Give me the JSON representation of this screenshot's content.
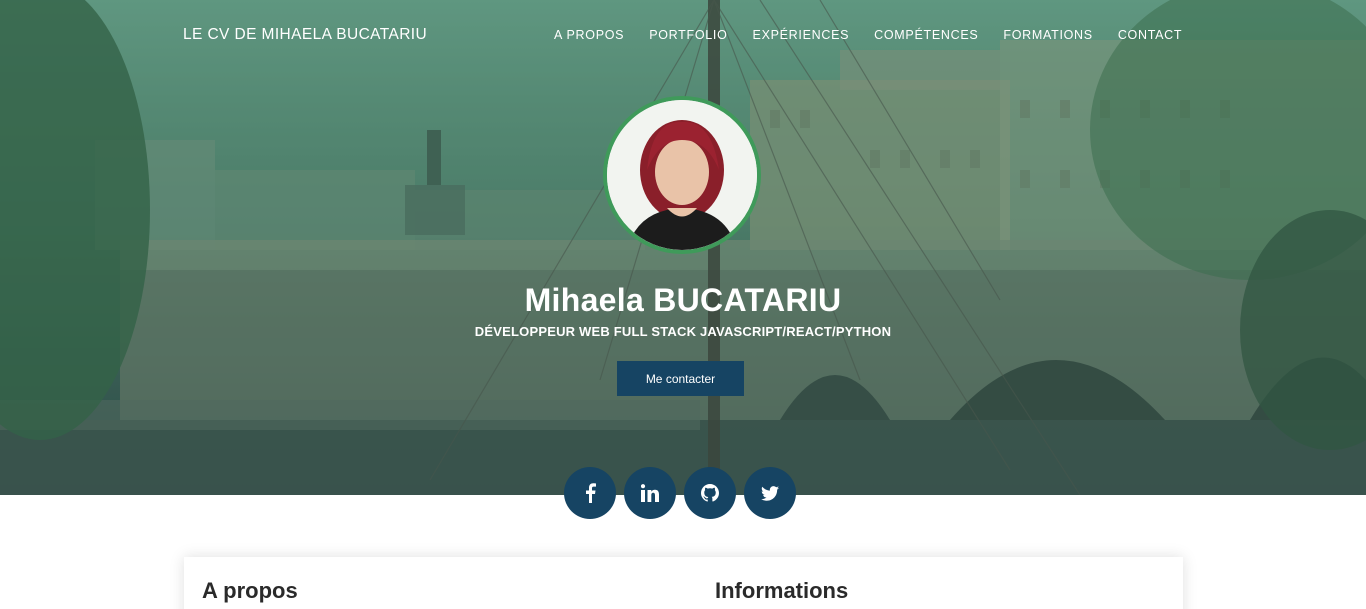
{
  "brand": "LE CV DE MIHAELA BUCATARIU",
  "nav": [
    "A PROPOS",
    "PORTFOLIO",
    "EXPÉRIENCES",
    "COMPÉTENCES",
    "FORMATIONS",
    "CONTACT"
  ],
  "hero": {
    "name": "Mihaela BUCATARIU",
    "subtitle": "DÉVELOPPEUR WEB FULL STACK JAVASCRIPT/REACT/PYTHON",
    "cta_label": "Me contacter"
  },
  "socials": [
    {
      "icon": "facebook-icon",
      "glyph": "f"
    },
    {
      "icon": "linkedin-icon",
      "glyph": "in"
    },
    {
      "icon": "github-icon",
      "glyph": ""
    },
    {
      "icon": "twitter-icon",
      "glyph": ""
    }
  ],
  "sections": {
    "about_title": "A propos",
    "info_title": "Informations"
  },
  "colors": {
    "accent": "#164463",
    "avatar_border": "#3f9a5a",
    "hero_overlay": "#5d8f7a"
  }
}
